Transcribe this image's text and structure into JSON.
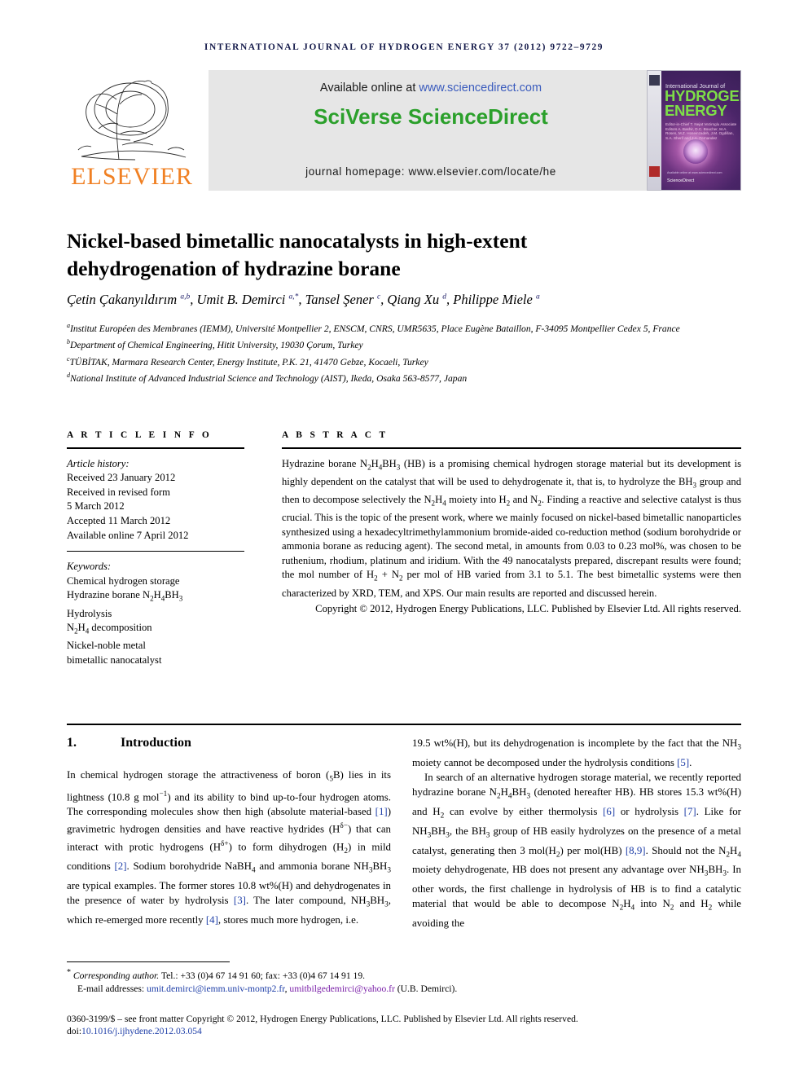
{
  "running_head": "INTERNATIONAL JOURNAL OF HYDROGEN ENERGY 37 (2012) 9722–9729",
  "masthead": {
    "publisher": "ELSEVIER",
    "available_prefix": "Available online at ",
    "available_url": "www.sciencedirect.com",
    "platform": "SciVerse ScienceDirect",
    "homepage": "journal homepage: www.elsevier.com/locate/he",
    "cover": {
      "line1": "International Journal of",
      "line2": "HYDROGEN",
      "line3": "ENERGY",
      "editors": "Editor-in-Chief  T. Nejat Veziroglu\nAssociate Editors  A. Bashir, D.C. Boucher, M.A. Rosen,\nM.Z. Hoseinzadeh, J.M. Ogdillan,\nS.A. Sherif and J.A. Fernandez",
      "science_direct": "ScienceDirect",
      "sd_tagline": "Available online at www.sciencedirect.com"
    },
    "colors": {
      "sciverse_green": "#2ba02b",
      "elsevier_orange": "#f08023",
      "link_blue": "#3a5bbd",
      "cover_purple": "#5a2a6a",
      "cover_green": "#7ede48"
    }
  },
  "title": "Nickel-based bimetallic nanocatalysts in high-extent dehydrogenation of hydrazine borane",
  "authors_html": "Çetin Çakanyıldırım <sup>a,b</sup>, Umit B. Demirci <sup>a,</sup><sup>*</sup>, Tansel Şener <sup>c</sup>, Qiang Xu <sup>d</sup>, Philippe Miele <sup>a</sup>",
  "affiliations": [
    {
      "marker": "a",
      "text": "Institut Européen des Membranes (IEMM), Université Montpellier 2, ENSCM, CNRS, UMR5635, Place Eugène Bataillon, F-34095 Montpellier Cedex 5, France"
    },
    {
      "marker": "b",
      "text": "Department of Chemical Engineering, Hitit University, 19030 Çorum, Turkey"
    },
    {
      "marker": "c",
      "text": "TÜBİTAK, Marmara Research Center, Energy Institute, P.K. 21, 41470 Gebze, Kocaeli, Turkey"
    },
    {
      "marker": "d",
      "text": "National Institute of Advanced Industrial Science and Technology (AIST), Ikeda, Osaka 563-8577, Japan"
    }
  ],
  "article_info": {
    "heading": "ARTICLE INFO",
    "history_label": "Article history:",
    "history": [
      "Received 23 January 2012",
      "Received in revised form",
      "5 March 2012",
      "Accepted 11 March 2012",
      "Available online 7 April 2012"
    ],
    "keywords_label": "Keywords:",
    "keywords_html": [
      "Chemical hydrogen storage",
      "Hydrazine borane N<sub>2</sub>H<sub>4</sub>BH<sub>3</sub>",
      "Hydrolysis",
      "N<sub>2</sub>H<sub>4</sub> decomposition",
      "Nickel-noble metal",
      "bimetallic nanocatalyst"
    ]
  },
  "abstract": {
    "heading": "ABSTRACT",
    "body_html": "Hydrazine borane N<sub>2</sub>H<sub>4</sub>BH<sub>3</sub> (HB) is a promising chemical hydrogen storage material but its development is highly dependent on the catalyst that will be used to dehydrogenate it, that is, to hydrolyze the BH<sub>3</sub> group and then to decompose selectively the N<sub>2</sub>H<sub>4</sub> moiety into H<sub>2</sub> and N<sub>2</sub>. Finding a reactive and selective catalyst is thus crucial. This is the topic of the present work, where we mainly focused on nickel-based bimetallic nanoparticles synthesized using a hexadecyltrimethylammonium bromide-aided co-reduction method (sodium borohydride or ammonia borane as reducing agent). The second metal, in amounts from 0.03 to 0.23 mol%, was chosen to be ruthenium, rhodium, platinum and iridium. With the 49 nanocatalysts prepared, discrepant results were found; the mol number of H<sub>2</sub> + N<sub>2</sub> per mol of HB varied from 3.1 to 5.1. The best bimetallic systems were then characterized by XRD, TEM, and XPS. Our main results are reported and discussed herein.",
    "copyright": "Copyright © 2012, Hydrogen Energy Publications, LLC. Published by Elsevier Ltd. All rights reserved."
  },
  "section": {
    "number": "1.",
    "heading": "Introduction"
  },
  "body": {
    "left_html": "In chemical hydrogen storage the attractiveness of boron (<sub>5</sub>B) lies in its lightness (10.8 g mol<sup class=\"inl\">−1</sup>) and its ability to bind up-to-four hydrogen atoms. The corresponding molecules show then high (absolute material-based <span class=\"ref\">[1]</span>) gravimetric hydrogen densities and have reactive hydrides (H<sup class=\"inl\">δ−</sup>) that can interact with protic hydrogens (H<sup class=\"inl\">δ+</sup>) to form dihydrogen (H<sub>2</sub>) in mild conditions <span class=\"ref\">[2]</span>. Sodium borohydride NaBH<sub>4</sub> and ammonia borane NH<sub>3</sub>BH<sub>3</sub> are typical examples. The former stores 10.8 wt%(H) and dehydrogenates in the presence of water by hydrolysis <span class=\"ref\">[3]</span>. The later compound, NH<sub>3</sub>BH<sub>3</sub>, which re-emerged more recently <span class=\"ref\">[4]</span>, stores much more hydrogen, i.e.",
    "right_p1_html": "19.5 wt%(H), but its dehydrogenation is incomplete by the fact that the NH<sub>3</sub> moiety cannot be decomposed under the hydrolysis conditions <span class=\"ref\">[5]</span>.",
    "right_p2_html": "In search of an alternative hydrogen storage material, we recently reported hydrazine borane N<sub>2</sub>H<sub>4</sub>BH<sub>3</sub> (denoted hereafter HB). HB stores 15.3 wt%(H) and H<sub>2</sub> can evolve by either thermolysis <span class=\"ref\">[6]</span> or hydrolysis <span class=\"ref\">[7]</span>. Like for NH<sub>3</sub>BH<sub>3</sub>, the BH<sub>3</sub> group of HB easily hydrolyzes on the presence of a metal catalyst, generating then 3 mol(H<sub>2</sub>) per mol(HB) <span class=\"ref\">[8,9]</span>. Should not the N<sub>2</sub>H<sub>4</sub> moiety dehydrogenate, HB does not present any advantage over NH<sub>3</sub>BH<sub>3</sub>. In other words, the first challenge in hydrolysis of HB is to find a catalytic material that would be able to decompose N<sub>2</sub>H<sub>4</sub> into N<sub>2</sub> and H<sub>2</sub> while avoiding the"
  },
  "footer": {
    "corresponding_html": "<span class=\"star\">*</span> <span class=\"fn-ital\">Corresponding author.</span> Tel.: +33 (0)4 67 14 91 60; fax: +33 (0)4 67 14 91 19.",
    "email_label": "E-mail addresses:",
    "email_1": "umit.demirci@iemm.univ-montp2.fr",
    "email_sep": ", ",
    "email_2": "umitbilgedemirci@yahoo.fr",
    "email_owner": " (U.B. Demirci).",
    "issn_line": "0360-3199/$ – see front matter Copyright © 2012, Hydrogen Energy Publications, LLC. Published by Elsevier Ltd. All rights reserved.",
    "doi_prefix": "doi:",
    "doi_value": "10.1016/j.ijhydene.2012.03.054"
  }
}
